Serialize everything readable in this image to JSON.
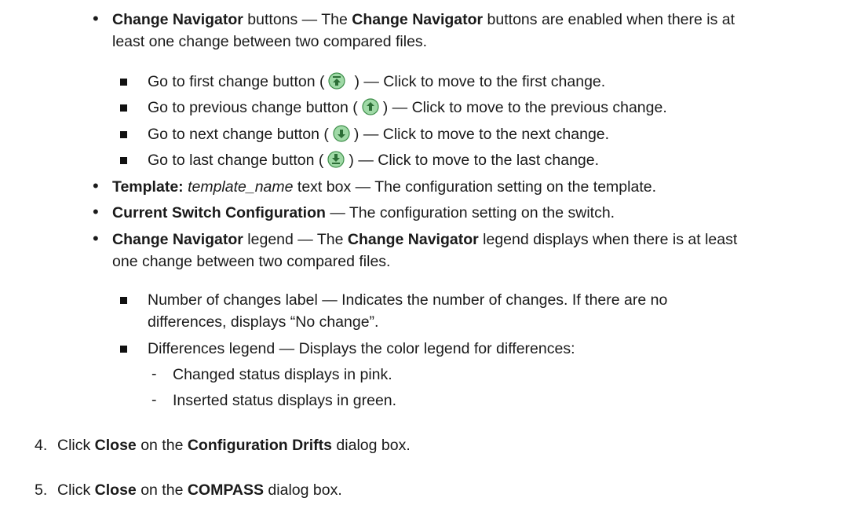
{
  "bullets": {
    "change_navigator_buttons": {
      "term": "Change Navigator",
      "term_suffix": " buttons — The ",
      "term2": "Change Navigator",
      "text_line1": " buttons are enabled when there is at",
      "text_line2": "least one change between two compared files."
    },
    "sub_buttons": [
      {
        "pre": "Go to first change button (",
        "post": ") — Click to move to the first change.",
        "icon": "first-change-icon"
      },
      {
        "pre": "Go to previous change button (",
        "post": ") — Click to move to the previous change.",
        "icon": "previous-change-icon"
      },
      {
        "pre": "Go to next change button (",
        "post": ") — Click to move to the next change.",
        "icon": "next-change-icon"
      },
      {
        "pre": "Go to last change button (",
        "post": ") — Click to move to the last change.",
        "icon": "last-change-icon"
      }
    ],
    "template": {
      "term": "Template:",
      "italic": "template_name",
      "text": " text box — The configuration setting on the template."
    },
    "current_switch": {
      "term": "Current Switch Configuration",
      "text": " — The configuration setting on the switch."
    },
    "legend": {
      "term": "Change Navigator",
      "mid": " legend — The ",
      "term2": "Change Navigator",
      "text_line1": " legend displays when there is at least",
      "text_line2": "one change between two compared files."
    },
    "legend_sub": {
      "number_line1": "Number of changes label — Indicates the number of changes. If there are no",
      "number_line2": "differences, displays “No change”.",
      "differences": "Differences legend — Displays the color legend for differences:",
      "changed": "Changed status displays in pink.",
      "inserted": "Inserted status displays in green."
    }
  },
  "steps": [
    {
      "num": "4.",
      "pre": "Click ",
      "b1": "Close",
      "mid": " on the ",
      "b2": "Configuration Drifts",
      "post": " dialog box."
    },
    {
      "num": "5.",
      "pre": "Click ",
      "b1": "Close",
      "mid": " on the ",
      "b2": "COMPASS",
      "post": " dialog box."
    }
  ],
  "colors": {
    "icon_fill": "#9fd9a6",
    "icon_stroke": "#3f8f4b",
    "icon_arrow": "#2c6e36"
  }
}
